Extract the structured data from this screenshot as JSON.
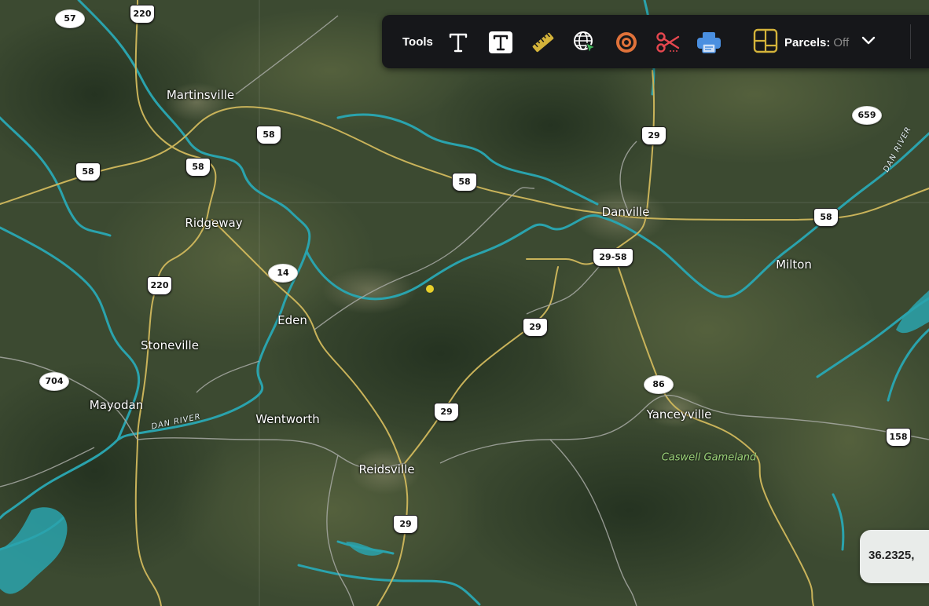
{
  "toolbar": {
    "tools_label": "Tools",
    "tools": [
      {
        "name": "text-icon"
      },
      {
        "name": "text-box-icon"
      },
      {
        "name": "ruler-icon"
      },
      {
        "name": "globe-cursor-icon"
      },
      {
        "name": "buffer-ring-icon"
      },
      {
        "name": "scissors-icon"
      },
      {
        "name": "print-icon"
      }
    ],
    "parcels": {
      "icon": "parcels-layer-icon",
      "label": "Parcels:",
      "value": "Off"
    }
  },
  "coordinate_readout": "36.2325,",
  "places": [
    {
      "id": "martinsville",
      "label": "Martinsville"
    },
    {
      "id": "ridgeway",
      "label": "Ridgeway"
    },
    {
      "id": "danville",
      "label": "Danville"
    },
    {
      "id": "milton",
      "label": "Milton"
    },
    {
      "id": "eden",
      "label": "Eden"
    },
    {
      "id": "stoneville",
      "label": "Stoneville"
    },
    {
      "id": "mayodan",
      "label": "Mayodan"
    },
    {
      "id": "wentworth",
      "label": "Wentworth"
    },
    {
      "id": "reidsville",
      "label": "Reidsville"
    },
    {
      "id": "yanceyville",
      "label": "Yanceyville"
    }
  ],
  "river_label": "DAN RIVER",
  "river_label_2": "DAN RIVER",
  "area_label": "Caswell Gameland",
  "route_shields": [
    {
      "id": "r57",
      "type": "state",
      "label": "57"
    },
    {
      "id": "r220a",
      "type": "us",
      "label": "220"
    },
    {
      "id": "r58a",
      "type": "us",
      "label": "58"
    },
    {
      "id": "r58b",
      "type": "us",
      "label": "58"
    },
    {
      "id": "r58c",
      "type": "us",
      "label": "58"
    },
    {
      "id": "r58d",
      "type": "us",
      "label": "58"
    },
    {
      "id": "r58e",
      "type": "us",
      "label": "58"
    },
    {
      "id": "r29a",
      "type": "us",
      "label": "29"
    },
    {
      "id": "r659",
      "type": "state",
      "label": "659"
    },
    {
      "id": "r2958",
      "type": "us",
      "label": "29-58"
    },
    {
      "id": "r14",
      "type": "state",
      "label": "14"
    },
    {
      "id": "r220b",
      "type": "us",
      "label": "220"
    },
    {
      "id": "r29b",
      "type": "us",
      "label": "29"
    },
    {
      "id": "r704",
      "type": "state",
      "label": "704"
    },
    {
      "id": "r86",
      "type": "state",
      "label": "86"
    },
    {
      "id": "r29c",
      "type": "us",
      "label": "29"
    },
    {
      "id": "r158",
      "type": "us",
      "label": "158"
    },
    {
      "id": "r29d",
      "type": "us",
      "label": "29"
    }
  ],
  "colors": {
    "water": "#2aa3ad",
    "highway": "#c9b35a",
    "local_road": "#a7a9a3",
    "toolbar_bg": "#16171a"
  }
}
